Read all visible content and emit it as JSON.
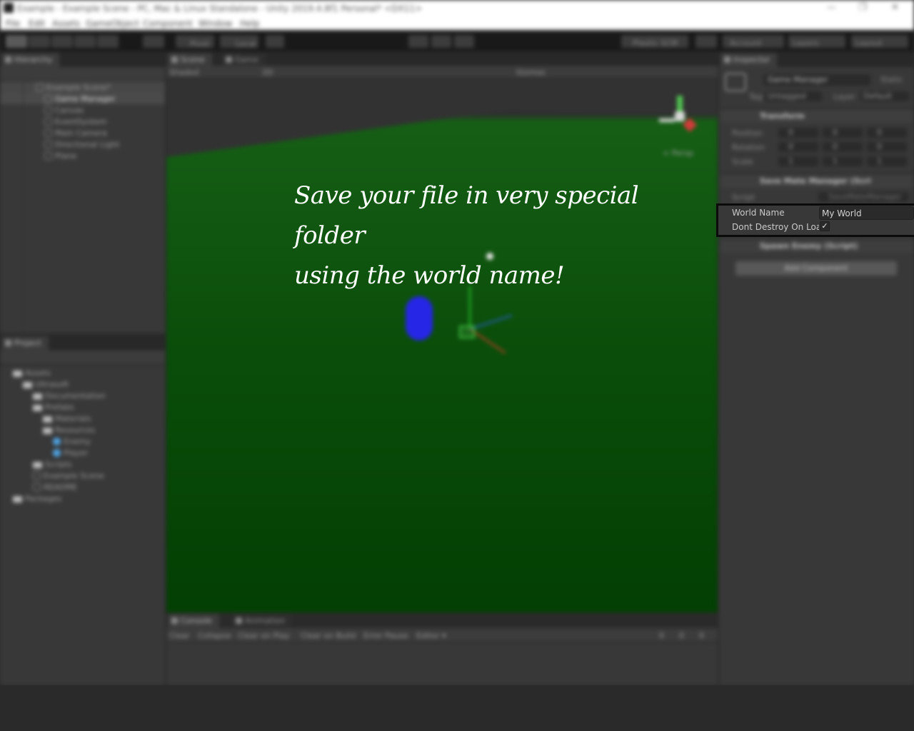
{
  "window": {
    "title": "Example - Example Scene - PC, Mac & Linux Standalone - Unity 2019.4.8f1 Personal* <DX11>",
    "controls": [
      "—",
      "❐",
      "✕"
    ]
  },
  "menu": [
    "File",
    "Edit",
    "Assets",
    "GameObject",
    "Component",
    "Window",
    "Help"
  ],
  "toolbar": {
    "pivot_label": "Pivot",
    "local_label": "Local",
    "collab_label": "Plastic SCM",
    "account_label": "Account",
    "layers_label": "Layers",
    "layout_label": "Layout"
  },
  "hierarchy": {
    "tab": "Hierarchy",
    "items": [
      {
        "label": "Example Scene*",
        "type": "scene"
      },
      {
        "label": "Game Manager",
        "type": "object"
      },
      {
        "label": "Canvas",
        "type": "object"
      },
      {
        "label": "EventSystem",
        "type": "object"
      },
      {
        "label": "Main Camera",
        "type": "object"
      },
      {
        "label": "Directional Light",
        "type": "object"
      },
      {
        "label": "Plane",
        "type": "object"
      }
    ]
  },
  "project": {
    "tab": "Project",
    "items": [
      {
        "label": "Assets",
        "type": "folder"
      },
      {
        "label": "Ultrasoft",
        "type": "folder"
      },
      {
        "label": "Documentation",
        "type": "folder"
      },
      {
        "label": "Prefabs",
        "type": "folder"
      },
      {
        "label": "Materials",
        "type": "folder"
      },
      {
        "label": "Resources",
        "type": "folder"
      },
      {
        "label": "Enemy",
        "type": "prefab"
      },
      {
        "label": "Player",
        "type": "prefab"
      },
      {
        "label": "Scripts",
        "type": "folder"
      },
      {
        "label": "Example Scene",
        "type": "scene"
      },
      {
        "label": "README",
        "type": "file"
      },
      {
        "label": "Packages",
        "type": "folder"
      }
    ]
  },
  "scene": {
    "tabs": [
      "Scene",
      "Game"
    ],
    "shading": "Shaded",
    "mode": "2D",
    "gizmos_label": "Gizmos",
    "persp_label": "< Persp",
    "caption": [
      "Save your file in very special folder",
      "using the world name!"
    ]
  },
  "console": {
    "tabs": [
      "Console",
      "Animation"
    ],
    "buttons": [
      "Clear",
      "Collapse",
      "Clear on Play",
      "Clear on Build",
      "Error Pause",
      "Editor ▾"
    ],
    "counts": [
      "0",
      "0",
      "0"
    ]
  },
  "inspector": {
    "tab": "Inspector",
    "object_name": "Game Manager",
    "static_label": "Static",
    "tag_label": "Tag",
    "tag_value": "Untagged",
    "layer_label": "Layer",
    "layer_value": "Default",
    "transform": {
      "title": "Transform",
      "rows": [
        {
          "label": "Position",
          "x": "0",
          "y": "0",
          "z": "0"
        },
        {
          "label": "Rotation",
          "x": "0",
          "y": "0",
          "z": "0"
        },
        {
          "label": "Scale",
          "x": "1",
          "y": "1",
          "z": "1"
        }
      ]
    },
    "save_component": {
      "title": "Save Mate Manager (Scri",
      "script_label": "Script",
      "script_value": "SaveMateManager"
    },
    "world_name_label": "World Name",
    "world_name_value": "My World",
    "dont_destroy_label": "Dont Destroy On Loa",
    "dont_destroy_checked": "✓",
    "spawn_component": {
      "title": "Spawn Enemy (Script)"
    },
    "add_component_label": "Add Component"
  }
}
